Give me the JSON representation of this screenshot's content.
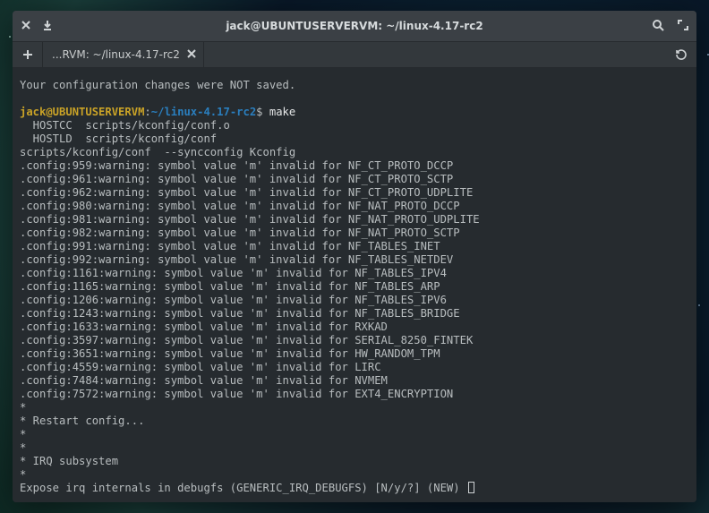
{
  "window": {
    "title": "jack@UBUNTUSERVERVM: ~/linux-4.17-rc2"
  },
  "tab": {
    "label": "...RVM: ~/linux-4.17-rc2"
  },
  "term": {
    "notice": "Your configuration changes were NOT saved.",
    "prompt_userhost": "jack@UBUNTUSERVERVM",
    "prompt_colon": ":",
    "prompt_path": "~/linux-4.17-rc2",
    "prompt_dollar": "$",
    "command": "make",
    "hostcc": "  HOSTCC  scripts/kconfig/conf.o",
    "hostld": "  HOSTLD  scripts/kconfig/conf",
    "syncline": "scripts/kconfig/conf  --syncconfig Kconfig",
    "warnings": [
      ".config:959:warning: symbol value 'm' invalid for NF_CT_PROTO_DCCP",
      ".config:961:warning: symbol value 'm' invalid for NF_CT_PROTO_SCTP",
      ".config:962:warning: symbol value 'm' invalid for NF_CT_PROTO_UDPLITE",
      ".config:980:warning: symbol value 'm' invalid for NF_NAT_PROTO_DCCP",
      ".config:981:warning: symbol value 'm' invalid for NF_NAT_PROTO_UDPLITE",
      ".config:982:warning: symbol value 'm' invalid for NF_NAT_PROTO_SCTP",
      ".config:991:warning: symbol value 'm' invalid for NF_TABLES_INET",
      ".config:992:warning: symbol value 'm' invalid for NF_TABLES_NETDEV",
      ".config:1161:warning: symbol value 'm' invalid for NF_TABLES_IPV4",
      ".config:1165:warning: symbol value 'm' invalid for NF_TABLES_ARP",
      ".config:1206:warning: symbol value 'm' invalid for NF_TABLES_IPV6",
      ".config:1243:warning: symbol value 'm' invalid for NF_TABLES_BRIDGE",
      ".config:1633:warning: symbol value 'm' invalid for RXKAD",
      ".config:3597:warning: symbol value 'm' invalid for SERIAL_8250_FINTEK",
      ".config:3651:warning: symbol value 'm' invalid for HW_RANDOM_TPM",
      ".config:4559:warning: symbol value 'm' invalid for LIRC",
      ".config:7484:warning: symbol value 'm' invalid for NVMEM",
      ".config:7572:warning: symbol value 'm' invalid for EXT4_ENCRYPTION"
    ],
    "tail": [
      "*",
      "* Restart config...",
      "*",
      "*",
      "* IRQ subsystem",
      "*"
    ],
    "prompt_question": "Expose irq internals in debugfs (GENERIC_IRQ_DEBUGFS) [N/y/?] (NEW) "
  }
}
